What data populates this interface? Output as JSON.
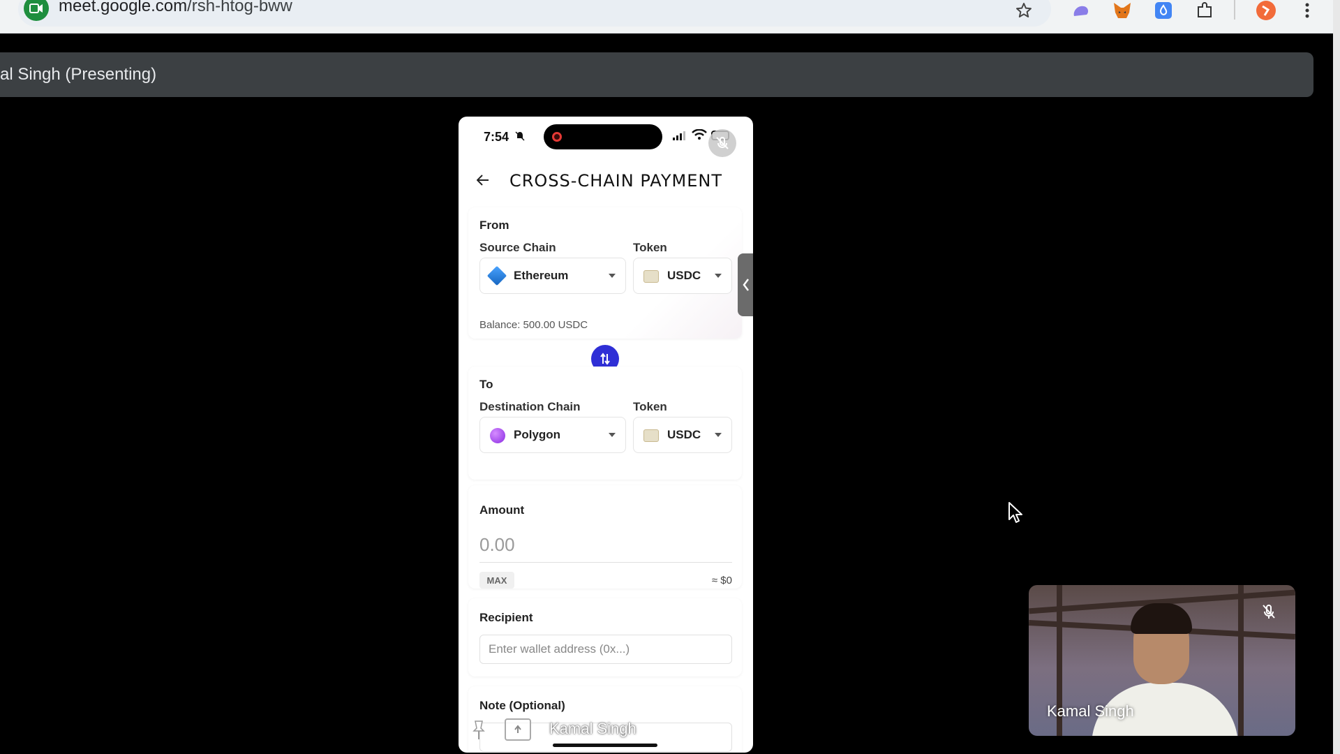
{
  "browser": {
    "url_host": "meet.google.com",
    "url_path": "/rsh-htog-bww",
    "icons": [
      "meet-site-icon",
      "star-icon",
      "extension-cloud-icon",
      "metamask-icon",
      "extension-blue-icon",
      "puzzle-icon",
      "profile-avatar-icon",
      "more-vert-icon"
    ]
  },
  "meet": {
    "presenting_label": "al Singh (Presenting)"
  },
  "phone": {
    "status": {
      "time": "7:54"
    },
    "header": {
      "title": "CROSS-CHAIN PAYMENT"
    },
    "from": {
      "section_label": "From",
      "chain_label": "Source Chain",
      "chain_value": "Ethereum",
      "token_label": "Token",
      "token_value": "USDC",
      "balance": "Balance: 500.00 USDC"
    },
    "to": {
      "section_label": "To",
      "chain_label": "Destination Chain",
      "chain_value": "Polygon",
      "token_label": "Token",
      "token_value": "USDC"
    },
    "amount": {
      "label": "Amount",
      "value": "0.00",
      "max_label": "MAX",
      "usd_approx": "≈ $0"
    },
    "recipient": {
      "label": "Recipient",
      "placeholder": "Enter wallet address (0x...)"
    },
    "note": {
      "label": "Note (Optional)"
    },
    "overlay_name": "Kamal Singh"
  },
  "self_view": {
    "name": "Kamal Singh"
  },
  "colors": {
    "accent": "#2f2fd6",
    "meet_green": "#1e8e3e"
  }
}
